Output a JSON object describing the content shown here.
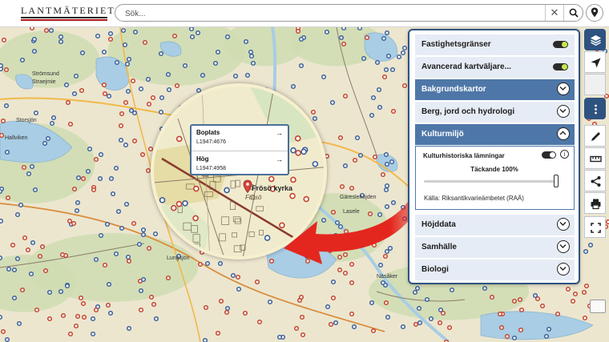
{
  "header": {
    "logo_text": "LANTMÄTERIET",
    "search_placeholder": "Sök...",
    "clear_glyph": "✕"
  },
  "map": {
    "background_color": "#ece6cf",
    "forest_color": "#cfdcb2",
    "water_color": "#a8cde4",
    "site_marker_colors": [
      "#3a5f9a",
      "#c4432c"
    ],
    "labels": [
      {
        "text": "Storsjön",
        "kind": "place"
      },
      {
        "text": "Frösö kyrka",
        "kind": "place"
      },
      {
        "text": "Frösö",
        "kind": "place"
      },
      {
        "text": "Gäreslehöjden",
        "kind": "place"
      },
      {
        "text": "Lasele",
        "kind": "place"
      },
      {
        "text": "Näsåker",
        "kind": "place"
      },
      {
        "text": "Lungsjön",
        "kind": "place"
      },
      {
        "text": "Hallviken",
        "kind": "place"
      },
      {
        "text": "Strömsund",
        "kind": "place"
      },
      {
        "text": "Straejmie",
        "kind": "place"
      }
    ]
  },
  "popup": {
    "items": [
      {
        "title": "Boplats",
        "id": "L1947:4676",
        "arrow": "→"
      },
      {
        "title": "Hög",
        "id": "L1947:4958",
        "arrow": "→"
      }
    ]
  },
  "bubble": {
    "place_name": "Frösö kyrka",
    "place_sub": "Frösö",
    "marker_color": "#d9453a"
  },
  "panel": {
    "rows": [
      {
        "label": "Fastighetsgränser",
        "kind": "toggle",
        "on": true
      },
      {
        "label": "Avancerad kartväljare...",
        "kind": "toggle",
        "on": true
      },
      {
        "label": "Bakgrundskartor",
        "kind": "expander",
        "expanded": false,
        "highlight": true
      },
      {
        "label": "Berg, jord och hydrologi",
        "kind": "expander",
        "expanded": false
      },
      {
        "label": "Kulturmiljö",
        "kind": "expander",
        "expanded": true,
        "highlight": true
      },
      {
        "label": "Höjddata",
        "kind": "expander",
        "expanded": false
      },
      {
        "label": "Samhälle",
        "kind": "expander",
        "expanded": false
      },
      {
        "label": "Biologi",
        "kind": "expander",
        "expanded": false
      }
    ],
    "sublayer": {
      "title": "Kulturhistoriska lämningar",
      "on": true,
      "info_glyph": "i",
      "opacity_label": "Täckande 100%",
      "opacity": 1.0,
      "source": "Källa: Riksantikvarieämbetet (RAÄ)"
    },
    "accent_color": "#4e77a8",
    "toggle_on_color": "#c7e74a"
  },
  "tools": [
    {
      "name": "layers-icon",
      "active": true
    },
    {
      "name": "navigate-icon",
      "active": false
    },
    {
      "name": "blank-icon",
      "active": false,
      "disabled": true
    },
    {
      "name": "more-icon",
      "active": true
    },
    {
      "name": "draw-icon",
      "active": false
    },
    {
      "name": "measure-icon",
      "active": false
    },
    {
      "name": "share-icon",
      "active": false
    },
    {
      "name": "print-icon",
      "active": false
    },
    {
      "name": "fullscreen-icon",
      "active": false
    }
  ],
  "annotation": {
    "arrow_color": "#e3271f"
  }
}
